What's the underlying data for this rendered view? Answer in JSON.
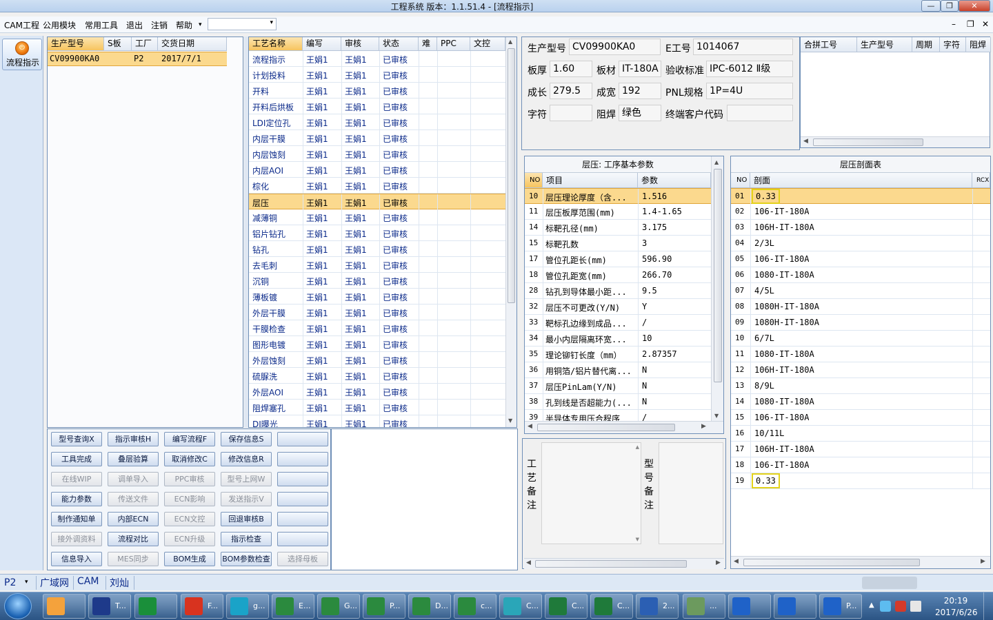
{
  "window": {
    "title": "工程系统   版本：1.1.51.4 - [流程指示]",
    "btn_min": "—",
    "btn_max": "❐",
    "btn_close": "✕"
  },
  "menu": {
    "items": [
      "CAM工程",
      "公用模块",
      "常用工具",
      "退出",
      "注销",
      "帮助"
    ],
    "help_arrow": "▾",
    "combo_value": "",
    "combo_arrow": "▾",
    "mdi_min": "–",
    "mdi_restore": "❐",
    "mdi_close": "✕"
  },
  "leftbar": {
    "flow_label": "流程指示"
  },
  "models": {
    "headers": [
      "生产型号",
      "S板",
      "工厂",
      "交货日期"
    ],
    "rows": [
      [
        "CV09900KA0",
        "",
        "P2",
        "2017/7/1"
      ]
    ]
  },
  "process": {
    "headers": [
      "工艺名称",
      "编写",
      "审核",
      "状态",
      "难",
      "PPC",
      "文控"
    ],
    "rows": [
      [
        "流程指示",
        "王娟1",
        "王娟1",
        "已审核"
      ],
      [
        "计划投料",
        "王娟1",
        "王娟1",
        "已审核"
      ],
      [
        "开料",
        "王娟1",
        "王娟1",
        "已审核"
      ],
      [
        "开料后烘板",
        "王娟1",
        "王娟1",
        "已审核"
      ],
      [
        "LDI定位孔",
        "王娟1",
        "王娟1",
        "已审核"
      ],
      [
        "内层干膜",
        "王娟1",
        "王娟1",
        "已审核"
      ],
      [
        "内层蚀刻",
        "王娟1",
        "王娟1",
        "已审核"
      ],
      [
        "内层AOI",
        "王娟1",
        "王娟1",
        "已审核"
      ],
      [
        "棕化",
        "王娟1",
        "王娟1",
        "已审核"
      ],
      [
        "层压",
        "王娟1",
        "王娟1",
        "已审核"
      ],
      [
        "减薄铜",
        "王娟1",
        "王娟1",
        "已审核"
      ],
      [
        "铝片钻孔",
        "王娟1",
        "王娟1",
        "已审核"
      ],
      [
        "钻孔",
        "王娟1",
        "王娟1",
        "已审核"
      ],
      [
        "去毛刺",
        "王娟1",
        "王娟1",
        "已审核"
      ],
      [
        "沉铜",
        "王娟1",
        "王娟1",
        "已审核"
      ],
      [
        "薄板镀",
        "王娟1",
        "王娟1",
        "已审核"
      ],
      [
        "外层干膜",
        "王娟1",
        "王娟1",
        "已审核"
      ],
      [
        "干膜检查",
        "王娟1",
        "王娟1",
        "已审核"
      ],
      [
        "图形电镀",
        "王娟1",
        "王娟1",
        "已审核"
      ],
      [
        "外层蚀刻",
        "王娟1",
        "王娟1",
        "已审核"
      ],
      [
        "硫脲洗",
        "王娟1",
        "王娟1",
        "已审核"
      ],
      [
        "外层AOI",
        "王娟1",
        "王娟1",
        "已审核"
      ],
      [
        "阻焊塞孔",
        "王娟1",
        "王娟1",
        "已审核"
      ],
      [
        "DI曝光",
        "王娟1",
        "王娟1",
        "已审核"
      ]
    ],
    "selected_index": 9
  },
  "info": {
    "prod_model_label": "生产型号",
    "prod_model": "CV09900KA0",
    "e_no_label": "E工号",
    "e_no": "1014067",
    "thickness_label": "板厚",
    "thickness": "1.60",
    "material_label": "板材",
    "material": "IT-180A",
    "accept_label": "验收标准",
    "accept": "IPC-6012 Ⅱ级",
    "len_label": "成长",
    "len": "279.5",
    "wid_label": "成宽",
    "wid": "192",
    "pnl_label": "PNL规格",
    "pnl": "1P=4U",
    "char_label": "字符",
    "char": "",
    "mask_label": "阻焊",
    "mask": "绿色",
    "cust_label": "终端客户代码",
    "cust": ""
  },
  "merge": {
    "headers": [
      "合拼工号",
      "生产型号",
      "周期",
      "字符",
      "阻焊"
    ]
  },
  "params": {
    "title": "层压: 工序基本参数",
    "headers": [
      "NO",
      "项目",
      "参数"
    ],
    "rows": [
      [
        "10",
        "层压理论厚度（含...",
        "1.516"
      ],
      [
        "11",
        "层压板厚范围(mm)",
        "1.4-1.65"
      ],
      [
        "14",
        "标靶孔径(mm)",
        "3.175"
      ],
      [
        "15",
        "标靶孔数",
        "3"
      ],
      [
        "17",
        "管位孔距长(mm)",
        "596.90"
      ],
      [
        "18",
        "管位孔距宽(mm)",
        "266.70"
      ],
      [
        "28",
        "钻孔到导体最小距...",
        "9.5"
      ],
      [
        "32",
        "层压不可更改(Y/N)",
        "Y"
      ],
      [
        "33",
        "靶标孔边缘到成品...",
        "/"
      ],
      [
        "34",
        "最小内层隔离环宽...",
        "10"
      ],
      [
        "35",
        "理论铆钉长度（mm）",
        "2.87357"
      ],
      [
        "36",
        "用铜箔/铝片替代离...",
        "N"
      ],
      [
        "37",
        "层压PinLam(Y/N)",
        "N"
      ],
      [
        "38",
        "孔到线是否超能力(...",
        "N"
      ],
      [
        "39",
        "半导体专用压合程序",
        "/"
      ]
    ]
  },
  "section": {
    "title": "层压剖面表",
    "headers": [
      "NO",
      "剖面",
      "RCX"
    ],
    "rows": [
      [
        "01",
        "0.33"
      ],
      [
        "02",
        "106-IT-180A"
      ],
      [
        "03",
        "106H-IT-180A"
      ],
      [
        "04",
        "2/3L"
      ],
      [
        "05",
        "106-IT-180A"
      ],
      [
        "06",
        "1080-IT-180A"
      ],
      [
        "07",
        "4/5L"
      ],
      [
        "08",
        "1080H-IT-180A"
      ],
      [
        "09",
        "1080H-IT-180A"
      ],
      [
        "10",
        "6/7L"
      ],
      [
        "11",
        "1080-IT-180A"
      ],
      [
        "12",
        "106H-IT-180A"
      ],
      [
        "13",
        "8/9L"
      ],
      [
        "14",
        "1080-IT-180A"
      ],
      [
        "15",
        "106-IT-180A"
      ],
      [
        "16",
        "10/11L"
      ],
      [
        "17",
        "106H-IT-180A"
      ],
      [
        "18",
        "106-IT-180A"
      ],
      [
        "19",
        "0.33"
      ]
    ],
    "highlighted": [
      "01",
      "19"
    ]
  },
  "remarks": {
    "process_label": "工艺备注",
    "model_label": "型号备注"
  },
  "buttons": [
    [
      "型号查询X",
      "指示审核H",
      "编写流程F",
      "保存信息S",
      ""
    ],
    [
      "工具完成",
      "叠层验算",
      "取消修改C",
      "修改信息R",
      ""
    ],
    [
      "在线WIP",
      "调单导入",
      "PPC审核",
      "型号上网W",
      ""
    ],
    [
      "能力参数",
      "传送文件",
      "ECN影响",
      "发送指示V",
      ""
    ],
    [
      "制作通知单",
      "内部ECN",
      "ECN文控",
      "回退审核B",
      ""
    ],
    [
      "接外调资料",
      "流程对比",
      "ECN升级",
      "指示检查",
      ""
    ],
    [
      "信息导入",
      "MES同步",
      "BOM生成",
      "BOM参数检查",
      "选择母板"
    ]
  ],
  "disabled_buttons": [
    "在线WIP",
    "调单导入",
    "PPC审核",
    "型号上网W",
    "传送文件",
    "ECN影响",
    "发送指示V",
    "ECN文控",
    "接外调资料",
    "ECN升级",
    "MES同步",
    "选择母板"
  ],
  "statusbar": {
    "factory": "P2",
    "arrow": "▾",
    "network": "广域网",
    "module": "CAM",
    "user": "刘灿"
  },
  "taskbar": {
    "start_icon": "windows-orb",
    "items": [
      "",
      "T...",
      "",
      "F...",
      "g...",
      "E...",
      "G...",
      "P...",
      "D...",
      "c...",
      "C...",
      "C...",
      "C...",
      "2...",
      "...",
      "",
      "",
      "P..."
    ],
    "clock_time": "20:19",
    "clock_date": "2017/6/26"
  },
  "colors": {
    "selected": "#fbd98e",
    "link_text": "#0b2a8a",
    "highlight_box": "#e3d21a"
  }
}
